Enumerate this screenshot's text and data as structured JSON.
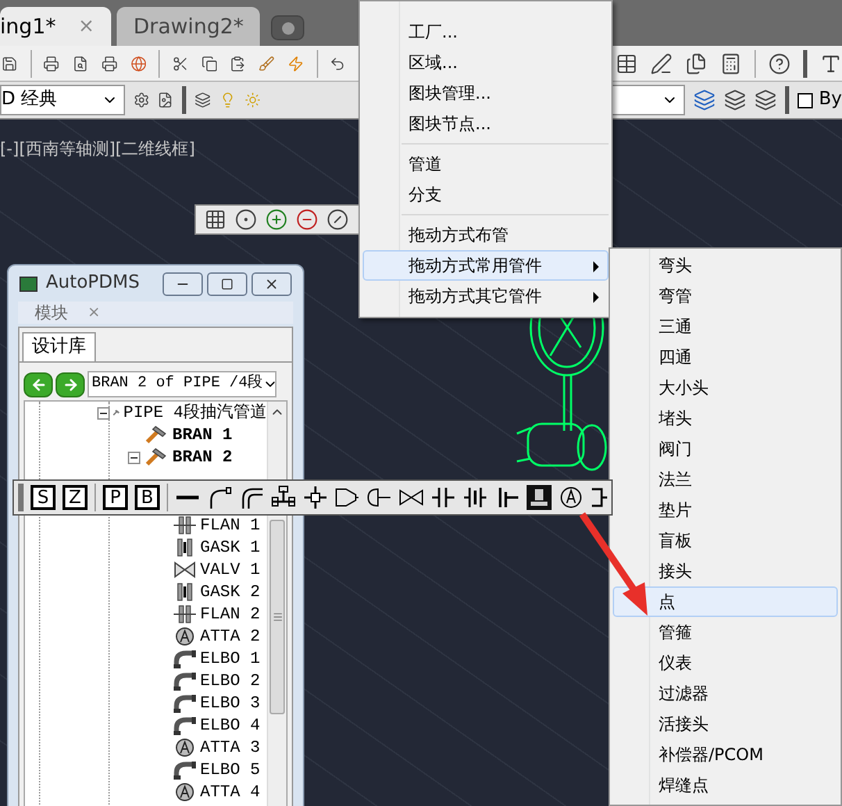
{
  "drawing_tabs": [
    {
      "label": "ing1*",
      "selected": true,
      "close": "×"
    },
    {
      "label": "Drawing2*",
      "selected": false
    }
  ],
  "workspace": {
    "value": "D 经典"
  },
  "layer_toggle": {
    "label": "By",
    "checked": false
  },
  "viewport_label": "[-][西南等轴测][二维线框]",
  "context_menu": {
    "items": [
      {
        "kind": "item",
        "label": "工厂...",
        "submenu": false,
        "selected": false
      },
      {
        "kind": "item",
        "label": "区域...",
        "submenu": false,
        "selected": false
      },
      {
        "kind": "item",
        "label": "图块管理...",
        "submenu": false,
        "selected": false
      },
      {
        "kind": "item",
        "label": "图块节点...",
        "submenu": false,
        "selected": false
      },
      {
        "kind": "separator"
      },
      {
        "kind": "item",
        "label": "管道",
        "submenu": false,
        "selected": false
      },
      {
        "kind": "item",
        "label": "分支",
        "submenu": false,
        "selected": false
      },
      {
        "kind": "separator"
      },
      {
        "kind": "item",
        "label": "拖动方式布管",
        "submenu": false,
        "selected": false
      },
      {
        "kind": "item",
        "label": "拖动方式常用管件",
        "submenu": true,
        "selected": true
      },
      {
        "kind": "item",
        "label": "拖动方式其它管件",
        "submenu": true,
        "selected": false
      }
    ]
  },
  "submenu": {
    "items": [
      {
        "label": "弯头",
        "selected": false
      },
      {
        "label": "弯管",
        "selected": false
      },
      {
        "label": "三通",
        "selected": false
      },
      {
        "label": "四通",
        "selected": false
      },
      {
        "label": "大小头",
        "selected": false
      },
      {
        "label": "堵头",
        "selected": false
      },
      {
        "label": "阀门",
        "selected": false
      },
      {
        "label": "法兰",
        "selected": false
      },
      {
        "label": "垫片",
        "selected": false
      },
      {
        "label": "盲板",
        "selected": false
      },
      {
        "label": "接头",
        "selected": false
      },
      {
        "label": "点",
        "selected": true
      },
      {
        "label": "管箍",
        "selected": false
      },
      {
        "label": "仪表",
        "selected": false
      },
      {
        "label": "过滤器",
        "selected": false
      },
      {
        "label": "活接头",
        "selected": false
      },
      {
        "label": "补偿器/PCOM",
        "selected": false
      },
      {
        "label": "焊缝点",
        "selected": false
      }
    ]
  },
  "autopdms": {
    "title": "AutoPDMS",
    "panel_title": "模块",
    "panel_close": "×",
    "tabs": [
      {
        "label": "设计库",
        "selected": true
      }
    ],
    "element": "BRAN 2 of PIPE /4段",
    "tree": [
      {
        "label": "PIPE 4段抽汽管道",
        "kind": "pipe",
        "bold": false,
        "expanded": true,
        "children": [
          {
            "label": "BRAN 1",
            "kind": "bran",
            "bold": true
          },
          {
            "label": "BRAN 2",
            "kind": "bran",
            "bold": true,
            "expanded": true,
            "children": [
              {
                "label": "FLAN 1",
                "kind": "flan",
                "bold": false
              },
              {
                "label": "GASK 1",
                "kind": "gask",
                "bold": false
              },
              {
                "label": "VALV 1",
                "kind": "valv",
                "bold": false
              },
              {
                "label": "GASK 2",
                "kind": "gask",
                "bold": false
              },
              {
                "label": "FLAN 2",
                "kind": "flan",
                "bold": false
              },
              {
                "label": "ATTA 2",
                "kind": "atta",
                "bold": false
              },
              {
                "label": "ELBO 1",
                "kind": "elbo",
                "bold": false
              },
              {
                "label": "ELBO 2",
                "kind": "elbo",
                "bold": false
              },
              {
                "label": "ELBO 3",
                "kind": "elbo",
                "bold": false
              },
              {
                "label": "ELBO 4",
                "kind": "elbo",
                "bold": false
              },
              {
                "label": "ATTA 3",
                "kind": "atta",
                "bold": false
              },
              {
                "label": "ELBO 5",
                "kind": "elbo",
                "bold": false
              },
              {
                "label": "ATTA 4",
                "kind": "atta",
                "bold": false
              }
            ]
          }
        ]
      }
    ]
  },
  "piping_toolbar": {
    "buttons": [
      "S",
      "Z",
      "P",
      "B"
    ]
  }
}
